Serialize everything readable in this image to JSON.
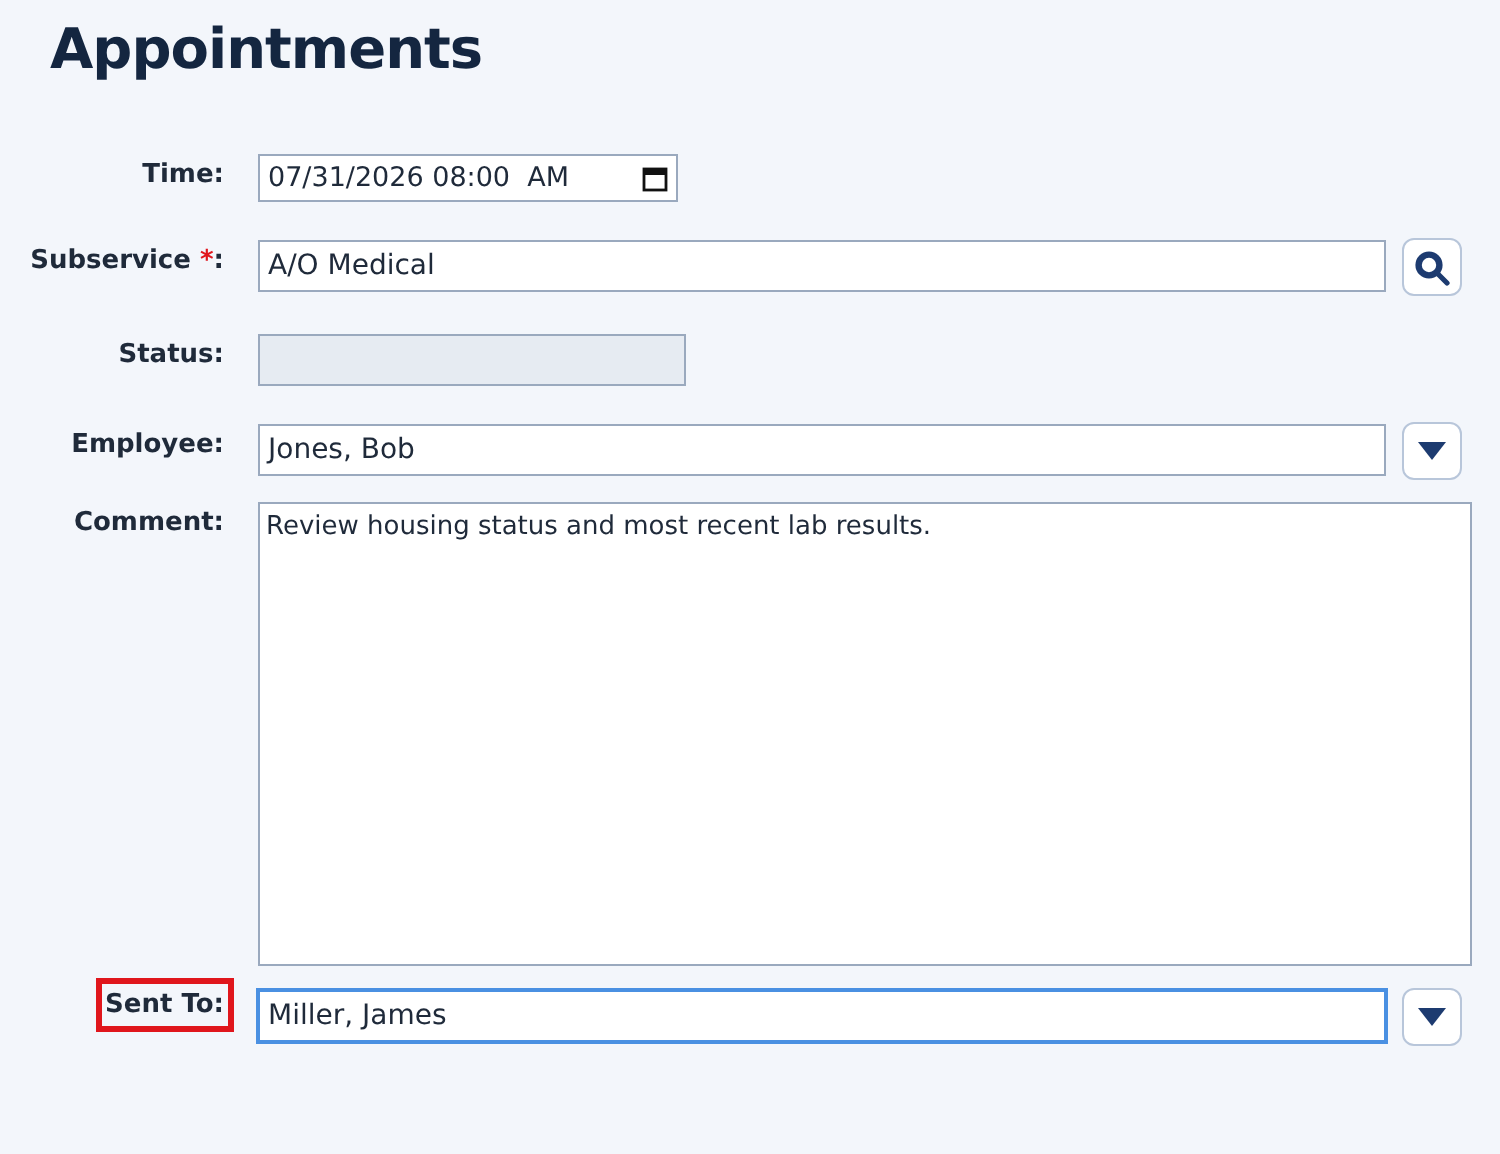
{
  "title": "Appointments",
  "fields": [
    {
      "kind": "datetime",
      "label": "Time:",
      "value": "07/31/2026 08:00  AM",
      "disabled": false,
      "focused": false,
      "highlighted": false
    },
    {
      "kind": "lookup",
      "label": "Subservice",
      "required_mark": "*",
      "label_end": ":",
      "value": "A/O Medical",
      "disabled": false,
      "focused": false,
      "highlighted": false
    },
    {
      "kind": "short",
      "label": "Status:",
      "disabled": true,
      "focused": false,
      "highlighted": false
    },
    {
      "kind": "dropdown",
      "label": "Employee:",
      "value": "Jones, Bob",
      "disabled": false,
      "focused": false,
      "highlighted": false
    },
    {
      "kind": "textarea",
      "label": "Comment:",
      "value": "Review housing status and most recent lab results.",
      "disabled": false,
      "focused": false,
      "highlighted": false
    },
    {
      "kind": "dropdown",
      "label": "Sent To:",
      "value": "Miller, James",
      "disabled": false,
      "focused": true,
      "highlighted": true
    }
  ]
}
